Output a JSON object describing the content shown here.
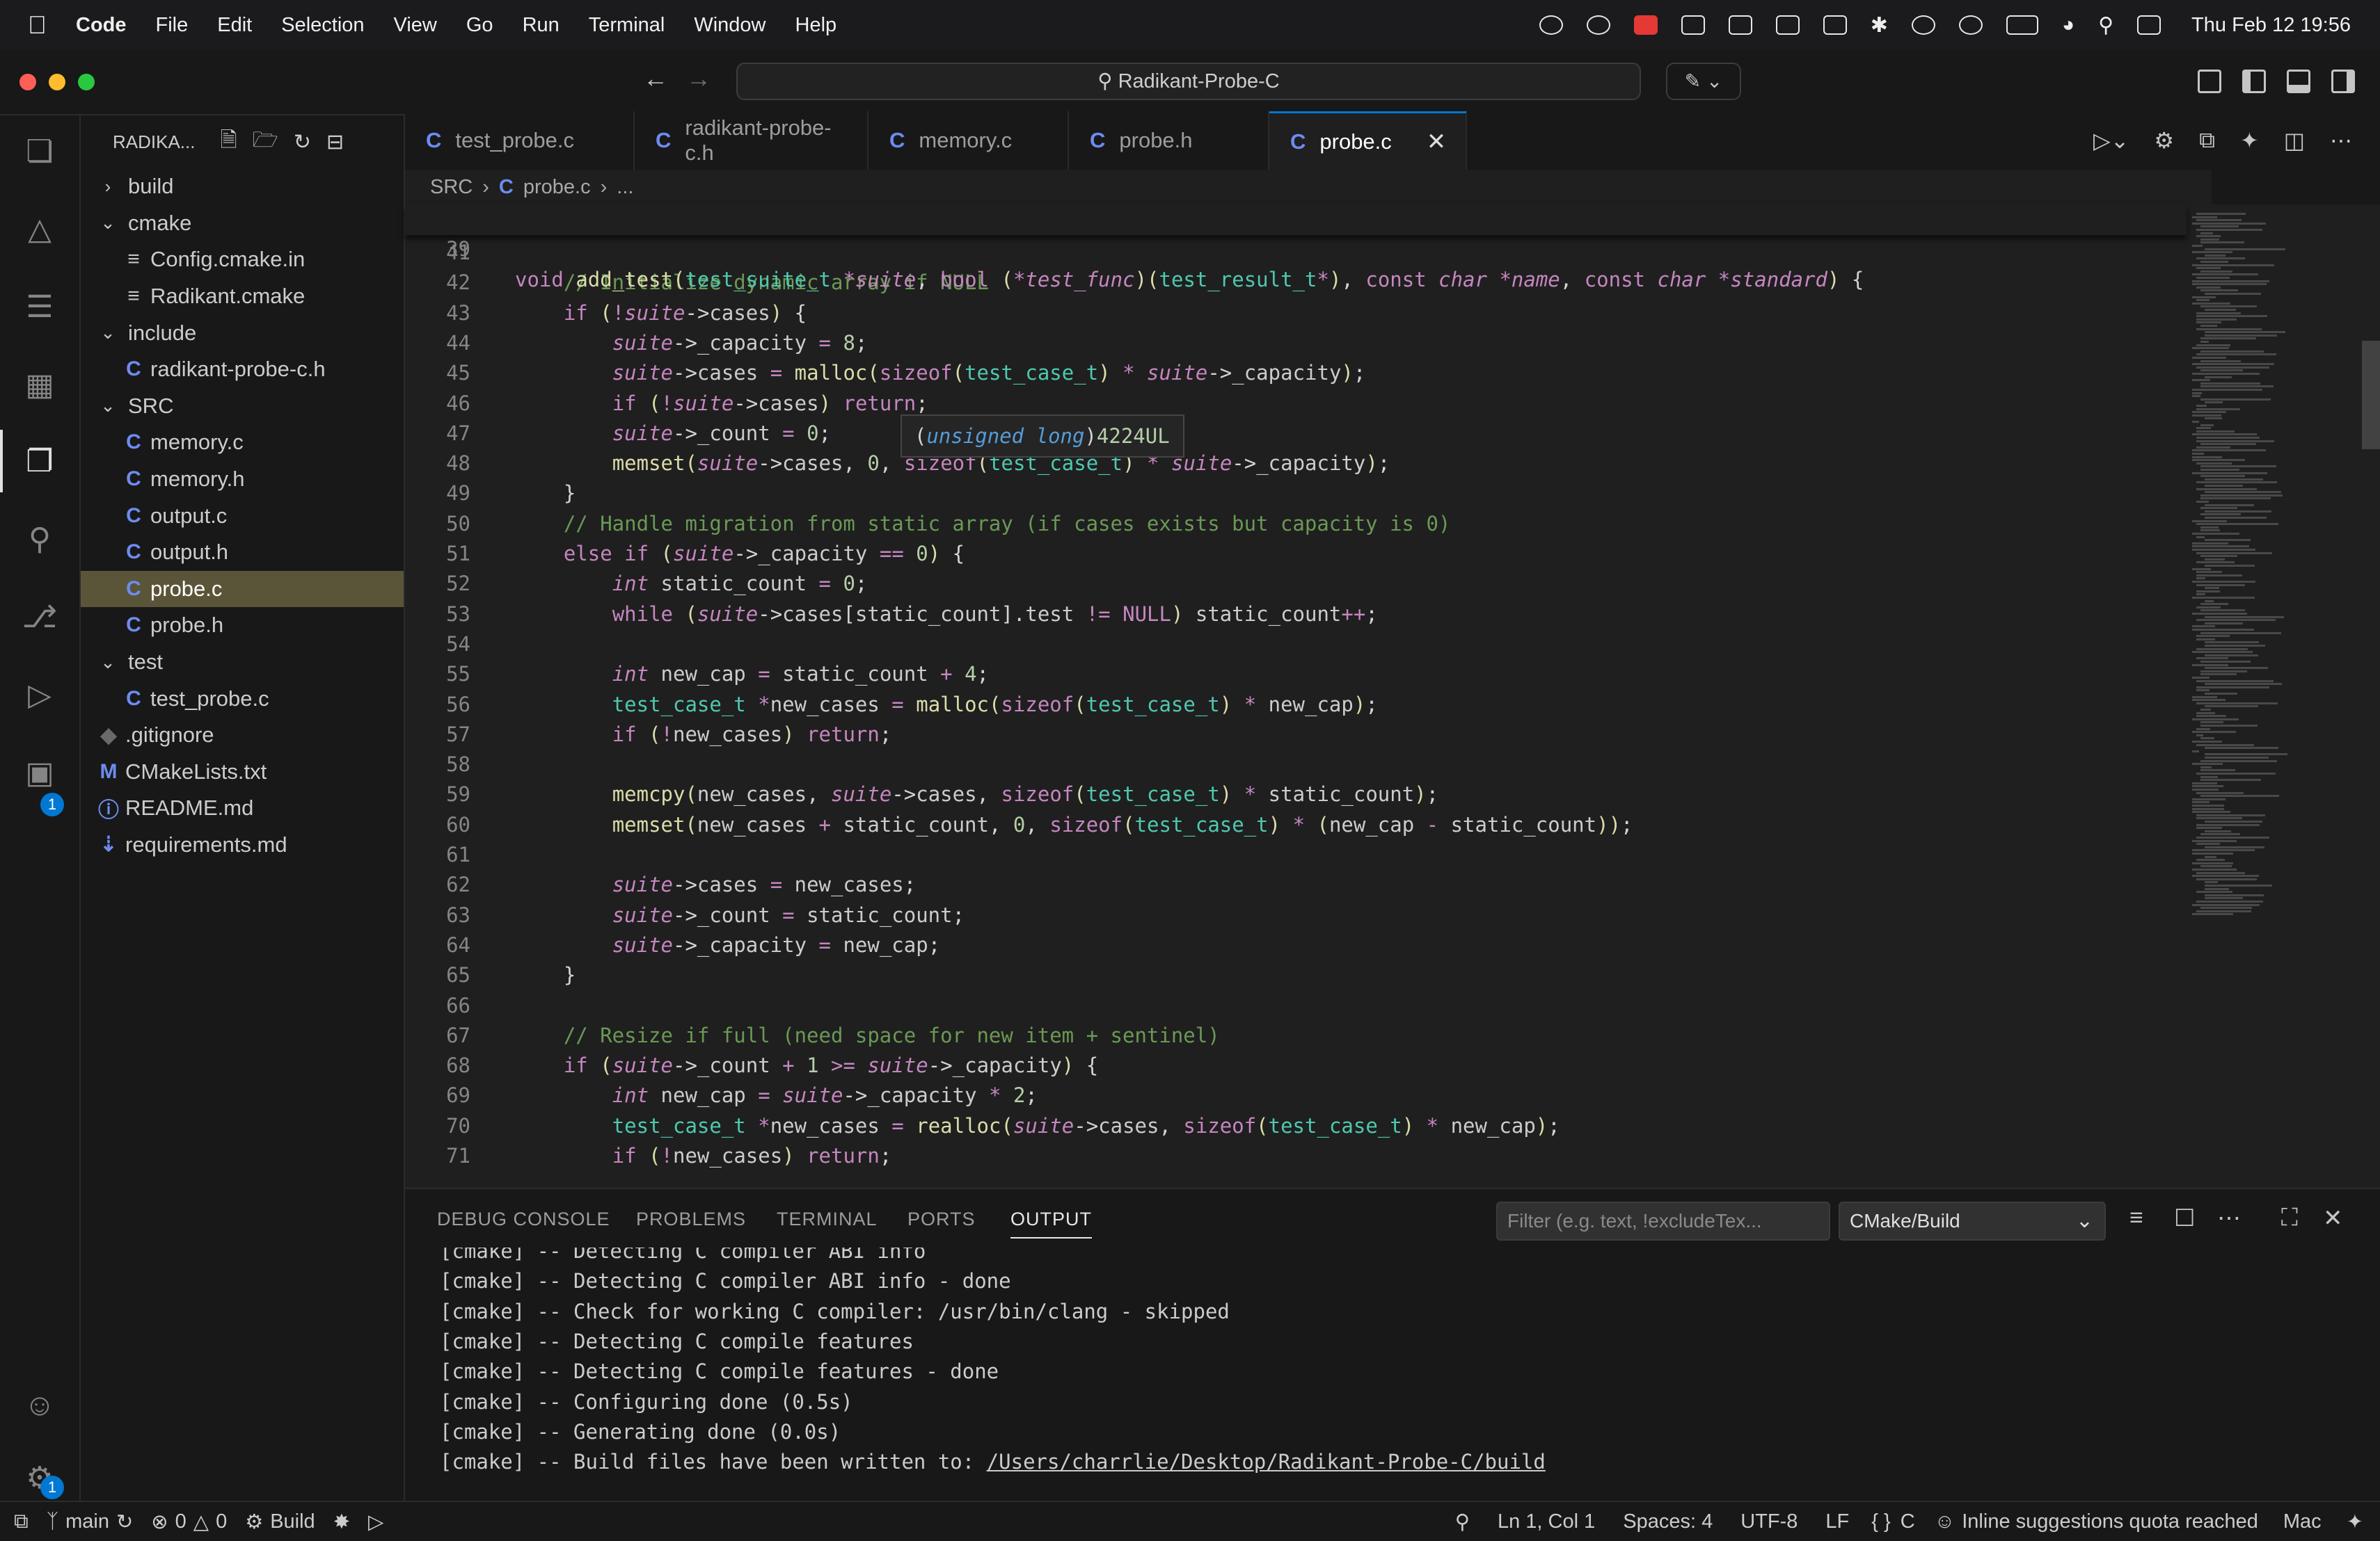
{
  "menubar": {
    "app": "Code",
    "items": [
      "File",
      "Edit",
      "Selection",
      "View",
      "Go",
      "Run",
      "Terminal",
      "Window",
      "Help"
    ],
    "clock": "Thu Feb 12  19:56"
  },
  "titlebar": {
    "search": "Radikant-Probe-C"
  },
  "explorer": {
    "title": "RADIKA...",
    "tree": [
      {
        "label": "build",
        "type": "folder",
        "collapsed": true,
        "depth": 0
      },
      {
        "label": "cmake",
        "type": "folder",
        "collapsed": false,
        "depth": 0
      },
      {
        "label": "Config.cmake.in",
        "type": "text",
        "depth": 1
      },
      {
        "label": "Radikant.cmake",
        "type": "text",
        "depth": 1
      },
      {
        "label": "include",
        "type": "folder",
        "collapsed": false,
        "depth": 0
      },
      {
        "label": "radikant-probe-c.h",
        "type": "c",
        "depth": 1
      },
      {
        "label": "SRC",
        "type": "folder",
        "collapsed": false,
        "depth": 0
      },
      {
        "label": "memory.c",
        "type": "c",
        "depth": 1
      },
      {
        "label": "memory.h",
        "type": "c",
        "depth": 1
      },
      {
        "label": "output.c",
        "type": "c",
        "depth": 1
      },
      {
        "label": "output.h",
        "type": "c",
        "depth": 1
      },
      {
        "label": "probe.c",
        "type": "c",
        "depth": 1,
        "selected": true
      },
      {
        "label": "probe.h",
        "type": "c",
        "depth": 1
      },
      {
        "label": "test",
        "type": "folder",
        "collapsed": false,
        "depth": 0
      },
      {
        "label": "test_probe.c",
        "type": "c",
        "depth": 1
      },
      {
        "label": ".gitignore",
        "type": "git",
        "depth": 0
      },
      {
        "label": "CMakeLists.txt",
        "type": "cmake",
        "depth": 0
      },
      {
        "label": "README.md",
        "type": "info",
        "depth": 0
      },
      {
        "label": "requirements.md",
        "type": "md",
        "depth": 0
      }
    ]
  },
  "tabs": [
    {
      "label": "test_probe.c",
      "active": false
    },
    {
      "label": "radikant-probe-c.h",
      "active": false
    },
    {
      "label": "memory.c",
      "active": false
    },
    {
      "label": "probe.h",
      "active": false
    },
    {
      "label": "probe.c",
      "active": true
    }
  ],
  "breadcrumb": {
    "folder": "SRC",
    "file": "probe.c",
    "more": "..."
  },
  "hover": {
    "type": "unsigned long",
    "value": "4224UL"
  },
  "editor": {
    "sticky": {
      "num": "39",
      "text": "void add_test(test_suite_t *suite, bool (*test_func)(test_result_t*), const char *name, const char *standard) {"
    },
    "lines": [
      {
        "num": "41",
        "text": ""
      },
      {
        "num": "42",
        "text": "    // Initialize dynamic array if NULL"
      },
      {
        "num": "43",
        "text": "    if (!suite->cases) {"
      },
      {
        "num": "44",
        "text": "        suite->_capacity = 8;"
      },
      {
        "num": "45",
        "text": "        suite->cases = malloc(sizeof(test_case_t) * suite->_capacity);"
      },
      {
        "num": "46",
        "text": "        if (!suite->cases) return;"
      },
      {
        "num": "47",
        "text": "        suite->_count = 0;"
      },
      {
        "num": "48",
        "text": "        memset(suite->cases, 0, sizeof(test_case_t) * suite->_capacity);"
      },
      {
        "num": "49",
        "text": "    }"
      },
      {
        "num": "50",
        "text": "    // Handle migration from static array (if cases exists but capacity is 0)"
      },
      {
        "num": "51",
        "text": "    else if (suite->_capacity == 0) {"
      },
      {
        "num": "52",
        "text": "        int static_count = 0;"
      },
      {
        "num": "53",
        "text": "        while (suite->cases[static_count].test != NULL) static_count++;"
      },
      {
        "num": "54",
        "text": ""
      },
      {
        "num": "55",
        "text": "        int new_cap = static_count + 4;"
      },
      {
        "num": "56",
        "text": "        test_case_t *new_cases = malloc(sizeof(test_case_t) * new_cap);"
      },
      {
        "num": "57",
        "text": "        if (!new_cases) return;"
      },
      {
        "num": "58",
        "text": ""
      },
      {
        "num": "59",
        "text": "        memcpy(new_cases, suite->cases, sizeof(test_case_t) * static_count);"
      },
      {
        "num": "60",
        "text": "        memset(new_cases + static_count, 0, sizeof(test_case_t) * (new_cap - static_count));"
      },
      {
        "num": "61",
        "text": ""
      },
      {
        "num": "62",
        "text": "        suite->cases = new_cases;"
      },
      {
        "num": "63",
        "text": "        suite->_count = static_count;"
      },
      {
        "num": "64",
        "text": "        suite->_capacity = new_cap;"
      },
      {
        "num": "65",
        "text": "    }"
      },
      {
        "num": "66",
        "text": ""
      },
      {
        "num": "67",
        "text": "    // Resize if full (need space for new item + sentinel)"
      },
      {
        "num": "68",
        "text": "    if (suite->_count + 1 >= suite->_capacity) {"
      },
      {
        "num": "69",
        "text": "        int new_cap = suite->_capacity * 2;"
      },
      {
        "num": "70",
        "text": "        test_case_t *new_cases = realloc(suite->cases, sizeof(test_case_t) * new_cap);"
      },
      {
        "num": "71",
        "text": "        if (!new_cases) return;"
      }
    ]
  },
  "panel": {
    "tabs": [
      "DEBUG CONSOLE",
      "PROBLEMS",
      "TERMINAL",
      "PORTS",
      "OUTPUT"
    ],
    "active_tab": "OUTPUT",
    "filter_placeholder": "Filter (e.g. text, !excludeTex...",
    "channel": "CMake/Build",
    "output": [
      "[cmake] -- Detecting C compiler ABI info",
      "[cmake] -- Detecting C compiler ABI info - done",
      "[cmake] -- Check for working C compiler: /usr/bin/clang - skipped",
      "[cmake] -- Detecting C compile features",
      "[cmake] -- Detecting C compile features - done",
      "[cmake] -- Configuring done (0.5s)",
      "[cmake] -- Generating done (0.0s)"
    ],
    "last_line_prefix": "[cmake] -- Build files have been written to: ",
    "last_line_link": "/Users/charrlie/Desktop/Radikant-Probe-C/build"
  },
  "statusbar": {
    "branch": "main",
    "errors": "0",
    "warnings": "0",
    "build": "Build",
    "position": "Ln 1, Col 1",
    "spaces": "Spaces: 4",
    "encoding": "UTF-8",
    "eol": "LF",
    "lang_icon": "{ }",
    "language": "C",
    "copilot": "Inline suggestions quota reached",
    "platform": "Mac"
  },
  "activity_badges": {
    "extensions": "1",
    "settings": "1"
  },
  "colors": {
    "accent": "#0078d4",
    "selected_row": "#5a5538",
    "c_icon": "#6d8cf0"
  }
}
